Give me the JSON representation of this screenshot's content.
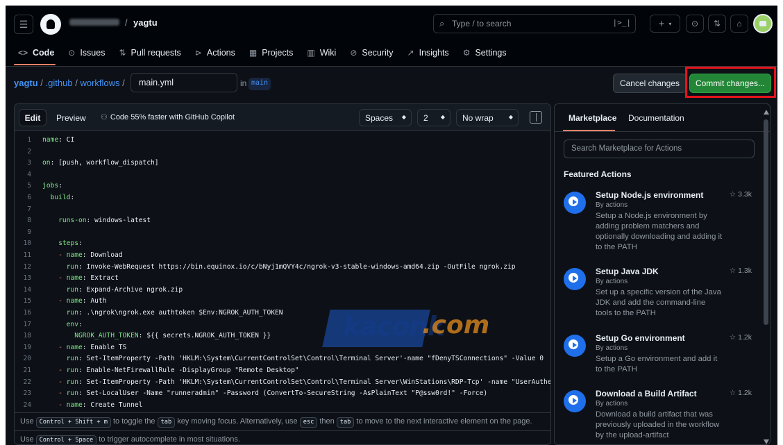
{
  "header": {
    "owner": "",
    "separator": "/",
    "repo": "yagtu",
    "search_placeholder": "Type / to search",
    "icons": [
      "hamburger-icon",
      "github-logo",
      "search-icon",
      "command-palette-icon",
      "plus-icon",
      "issues-icon",
      "pull-requests-icon",
      "inbox-icon",
      "avatar"
    ]
  },
  "tabs": [
    {
      "label": "Code",
      "icon": "code-icon",
      "glyph": "<>"
    },
    {
      "label": "Issues",
      "icon": "issue-icon",
      "glyph": "⊙"
    },
    {
      "label": "Pull requests",
      "icon": "pr-icon",
      "glyph": "⇅"
    },
    {
      "label": "Actions",
      "icon": "play-icon",
      "glyph": "⊳"
    },
    {
      "label": "Projects",
      "icon": "table-icon",
      "glyph": "▦"
    },
    {
      "label": "Wiki",
      "icon": "book-icon",
      "glyph": "▥"
    },
    {
      "label": "Security",
      "icon": "shield-icon",
      "glyph": "⊘"
    },
    {
      "label": "Insights",
      "icon": "graph-icon",
      "glyph": "↗"
    },
    {
      "label": "Settings",
      "icon": "gear-icon",
      "glyph": "⚙"
    }
  ],
  "path": {
    "repo": "yagtu",
    "dir1": ".github",
    "dir2": "workflows",
    "sep": "/",
    "filename": "main.yml",
    "in_label": "in",
    "branch": "main"
  },
  "actions": {
    "cancel": "Cancel changes",
    "commit": "Commit changes..."
  },
  "editor": {
    "edit_tab": "Edit",
    "preview_tab": "Preview",
    "copilot_note": "Code 55% faster with GitHub Copilot",
    "indent_mode": "Spaces",
    "indent_size": "2",
    "wrap_mode": "No wrap",
    "lines": [
      {
        "no": "1",
        "key": "name",
        "rest": " CI",
        "indent": ""
      },
      {
        "no": "2",
        "key": "",
        "rest": "",
        "indent": ""
      },
      {
        "no": "3",
        "key": "on",
        "rest": " [push, workflow_dispatch]",
        "indent": ""
      },
      {
        "no": "4",
        "key": "",
        "rest": "",
        "indent": ""
      },
      {
        "no": "5",
        "key": "jobs",
        "rest": "",
        "indent": ""
      },
      {
        "no": "6",
        "key": "build",
        "rest": "",
        "indent": "  "
      },
      {
        "no": "7",
        "key": "",
        "rest": "",
        "indent": ""
      },
      {
        "no": "8",
        "key": "runs-on",
        "rest": " windows-latest",
        "indent": "    "
      },
      {
        "no": "9",
        "key": "",
        "rest": "",
        "indent": ""
      },
      {
        "no": "10",
        "key": "steps",
        "rest": "",
        "indent": "    "
      },
      {
        "no": "11",
        "key": "name",
        "rest": " Download",
        "indent": "    - "
      },
      {
        "no": "12",
        "key": "run",
        "rest": " Invoke-WebRequest https://bin.equinox.io/c/bNyj1mQVY4c/ngrok-v3-stable-windows-amd64.zip -OutFile ngrok.zip",
        "indent": "      "
      },
      {
        "no": "13",
        "key": "name",
        "rest": " Extract",
        "indent": "    - "
      },
      {
        "no": "14",
        "key": "run",
        "rest": " Expand-Archive ngrok.zip",
        "indent": "      "
      },
      {
        "no": "15",
        "key": "name",
        "rest": " Auth",
        "indent": "    - "
      },
      {
        "no": "16",
        "key": "run",
        "rest": " .\\ngrok\\ngrok.exe authtoken $Env:NGROK_AUTH_TOKEN",
        "indent": "      "
      },
      {
        "no": "17",
        "key": "env",
        "rest": "",
        "indent": "      "
      },
      {
        "no": "18",
        "key": "NGROK_AUTH_TOKEN",
        "rest": " ${{ secrets.NGROK_AUTH_TOKEN }}",
        "indent": "        "
      },
      {
        "no": "19",
        "key": "name",
        "rest": " Enable TS",
        "indent": "    - "
      },
      {
        "no": "20",
        "key": "run",
        "rest": " Set-ItemProperty -Path 'HKLM:\\System\\CurrentControlSet\\Control\\Terminal Server'-name \"fDenyTSConnections\" -Value 0",
        "indent": "      "
      },
      {
        "no": "21",
        "key": "run",
        "rest": " Enable-NetFirewallRule -DisplayGroup \"Remote Desktop\"",
        "indent": "    - "
      },
      {
        "no": "22",
        "key": "run",
        "rest": " Set-ItemProperty -Path 'HKLM:\\System\\CurrentControlSet\\Control\\Terminal Server\\WinStations\\RDP-Tcp' -name \"UserAuthenti",
        "indent": "    - "
      },
      {
        "no": "23",
        "key": "run",
        "rest": " Set-LocalUser -Name \"runneradmin\" -Password (ConvertTo-SecureString -AsPlainText \"P@ssw0rd!\" -Force)",
        "indent": "    - "
      },
      {
        "no": "24",
        "key": "name",
        "rest": " Create Tunnel",
        "indent": "    - "
      }
    ],
    "hint1": {
      "use": "Use",
      "k1": "Control + Shift + m",
      "t1": "to toggle the",
      "k2": "tab",
      "t2": "key moving focus. Alternatively, use",
      "k3": "esc",
      "t3": "then",
      "k4": "tab",
      "t4": "to move to the next interactive element on the page."
    },
    "hint2": {
      "use": "Use",
      "k1": "Control + Space",
      "t1": "to trigger autocomplete in most situations."
    },
    "watermark": {
      "word": "kaconk",
      "suffix": ".com"
    }
  },
  "sidebar": {
    "tab_marketplace": "Marketplace",
    "tab_docs": "Documentation",
    "search_placeholder": "Search Marketplace for Actions",
    "featured_title": "Featured Actions",
    "items": [
      {
        "title": "Setup Node.js environment",
        "by": "By actions",
        "stars": "3.3k",
        "desc": "Setup a Node.js environment by adding problem matchers and optionally downloading and adding it to the PATH"
      },
      {
        "title": "Setup Java JDK",
        "by": "By actions",
        "stars": "1.3k",
        "desc": "Set up a specific version of the Java JDK and add the command-line tools to the PATH"
      },
      {
        "title": "Setup Go environment",
        "by": "By actions",
        "stars": "1.2k",
        "desc": "Setup a Go environment and add it to the PATH"
      },
      {
        "title": "Download a Build Artifact",
        "by": "By actions",
        "stars": "1.2k",
        "desc": "Download a build artifact that was previously uploaded in the workflow by the upload-artifact"
      }
    ]
  },
  "colors": {
    "bg": "#0d1117",
    "header_bg": "#010409",
    "link": "#4493f8",
    "commit_green": "#238636",
    "highlight_red": "#e3141a",
    "yaml_key": "#7ee787"
  }
}
